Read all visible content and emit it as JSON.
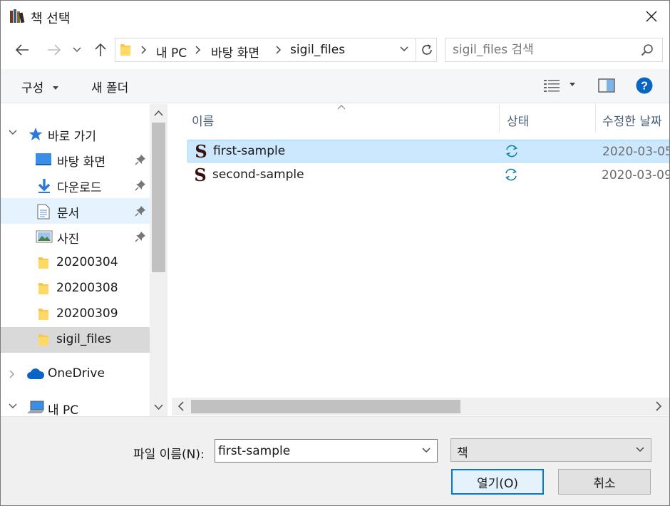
{
  "window": {
    "title": "책 선택"
  },
  "navigation": {
    "breadcrumbs": [
      "내 PC",
      "바탕 화면",
      "sigil_files"
    ],
    "search_placeholder": "sigil_files 검색"
  },
  "toolbar": {
    "organize_label": "구성",
    "new_folder_label": "새 폴더"
  },
  "sidebar": {
    "quick_access_label": "바로 가기",
    "items": [
      {
        "label": "바탕 화면",
        "icon": "desktop-icon",
        "pinned": true
      },
      {
        "label": "다운로드",
        "icon": "download-icon",
        "pinned": true
      },
      {
        "label": "문서",
        "icon": "documents-icon",
        "pinned": true,
        "selected": true
      },
      {
        "label": "사진",
        "icon": "pictures-icon",
        "pinned": true
      },
      {
        "label": "20200304",
        "icon": "folder-icon"
      },
      {
        "label": "20200308",
        "icon": "folder-icon"
      },
      {
        "label": "20200309",
        "icon": "folder-icon"
      },
      {
        "label": "sigil_files",
        "icon": "folder-icon",
        "current": true
      }
    ],
    "onedrive_label": "OneDrive",
    "thispc_label": "내 PC"
  },
  "filelist": {
    "columns": [
      "이름",
      "상태",
      "수정한 날짜"
    ],
    "rows": [
      {
        "name": "first-sample",
        "status": "sync-icon",
        "date": "2020-03-05",
        "selected": true
      },
      {
        "name": "second-sample",
        "status": "sync-icon",
        "date": "2020-03-09"
      }
    ]
  },
  "footer": {
    "filename_label": "파일 이름(N):",
    "filename_value": "first-sample",
    "filetype_value": "책",
    "open_label": "열기(O)",
    "cancel_label": "취소"
  },
  "colors": {
    "accent": "#0078d7",
    "selection": "#cce8ff",
    "sync": "#0a7fa3"
  }
}
